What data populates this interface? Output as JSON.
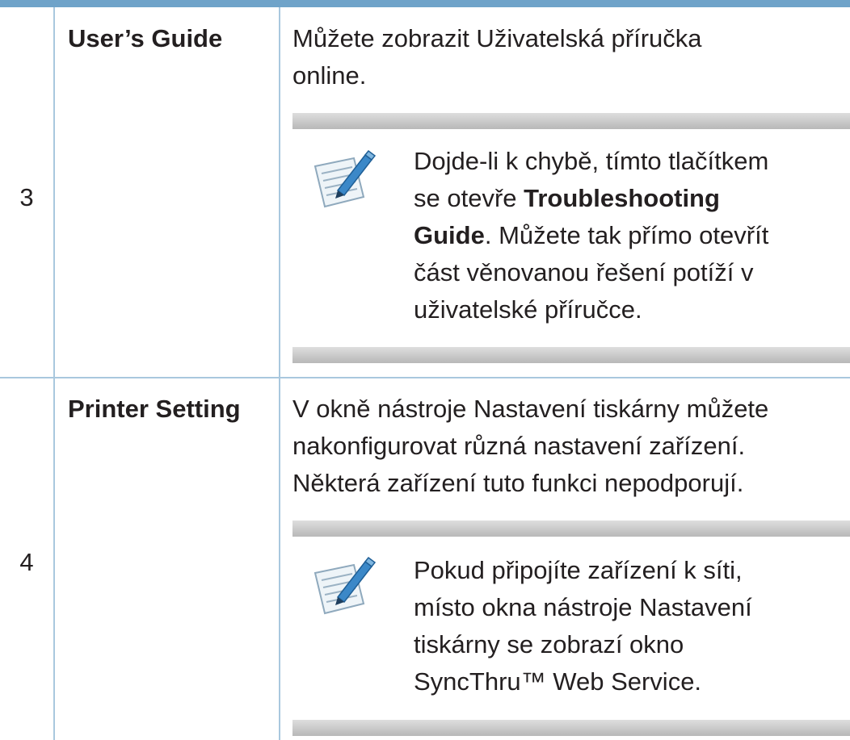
{
  "rows": [
    {
      "number": "3",
      "feature": "User’s Guide",
      "description": [
        "Můžete zobrazit Uživatelská příručka",
        "online."
      ],
      "note": {
        "icon": "note-pencil-icon",
        "line1": "Dojde-li k chybě, tímto tlačítkem",
        "line2_pre": "se otevře ",
        "bold1": "Troubleshooting",
        "bold2": "Guide",
        "line3_post": ". Můžete tak přímo otevřít",
        "line4": "část věnovanou řešení potíží v",
        "line5": "uživatelské příručce."
      }
    },
    {
      "number": "4",
      "feature": "Printer Setting",
      "description": [
        "V okně nástroje Nastavení tiskárny můžete",
        "nakonfigurovat různá nastavení zařízení.",
        "Některá zařízení tuto funkci nepodporují."
      ],
      "note": {
        "icon": "note-pencil-icon",
        "lines": [
          "Pokud připojíte zařízení k síti,",
          "místo okna nástroje Nastavení",
          "tiskárny se zobrazí okno",
          "SyncThru™ Web Service."
        ]
      }
    }
  ],
  "colors": {
    "top_rule": "#6fa3c9",
    "grid_lines": "#a9c8de",
    "text": "#231f20",
    "note_band": "#c9c9c9"
  }
}
